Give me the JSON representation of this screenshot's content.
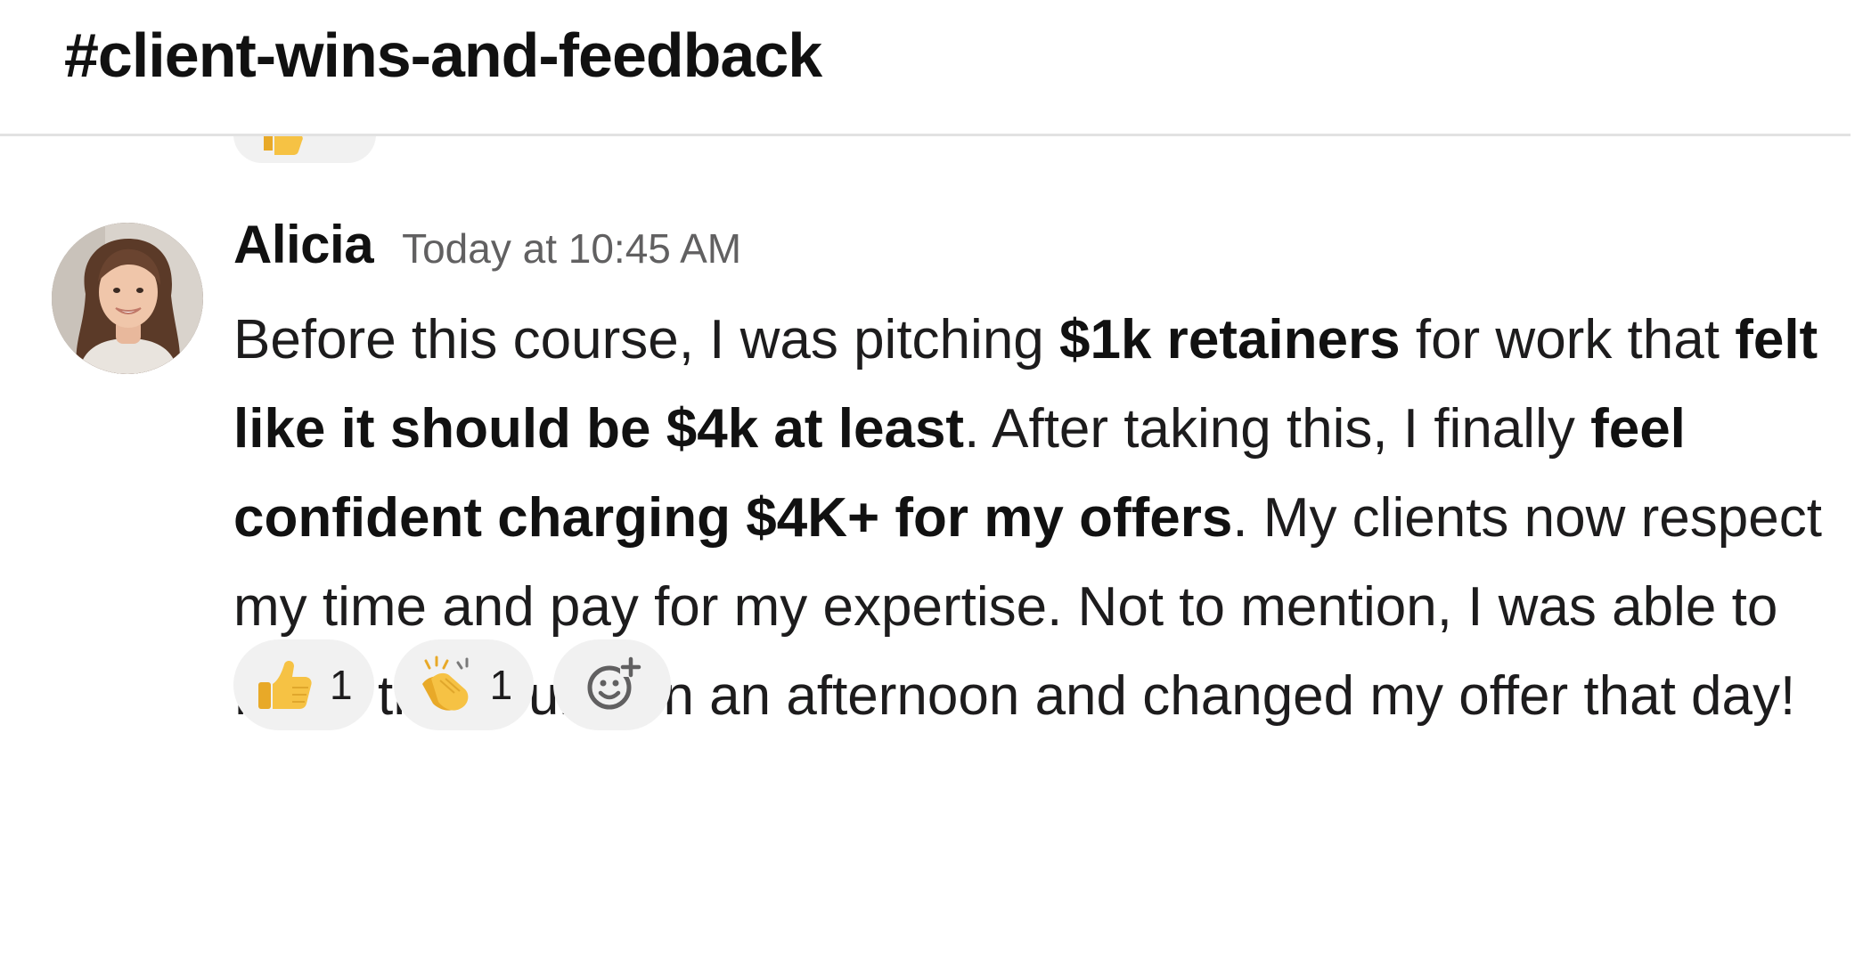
{
  "channel": {
    "name": "#client-wins-and-feedback"
  },
  "message": {
    "author": "Alicia",
    "timestamp": "Today at 10:45 AM",
    "segments": [
      {
        "text": "Before this course, I was pitching ",
        "bold": false
      },
      {
        "text": "$1k retainers",
        "bold": true
      },
      {
        "text": " for work that ",
        "bold": false
      },
      {
        "text": "felt like it should be $4k at least",
        "bold": true
      },
      {
        "text": ". After taking this, I finally ",
        "bold": false
      },
      {
        "text": "feel confident charging $4K+ for my offers",
        "bold": true
      },
      {
        "text": ". My clients now respect my time and pay for my expertise. Not to mention, I was able to finish the course in an afternoon and changed my offer that day!",
        "bold": false
      }
    ]
  },
  "reactions": [
    {
      "icon": "thumbs-up-icon",
      "count": "1"
    },
    {
      "icon": "clapping-hands-icon",
      "count": "1"
    }
  ],
  "add_reaction": {
    "icon": "add-reaction-icon"
  },
  "colors": {
    "pill_background": "#f1f1f1",
    "emoji_yellow": "#f6c244",
    "divider": "#e2e2e2"
  }
}
